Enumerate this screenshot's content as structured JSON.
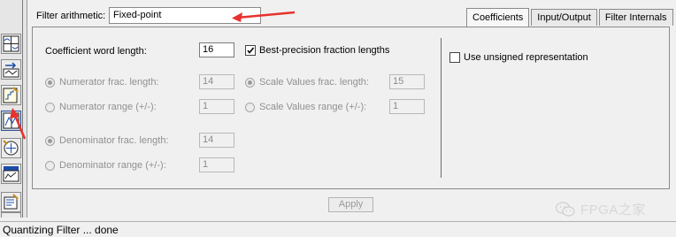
{
  "filter_arithmetic": {
    "label": "Filter arithmetic:",
    "value": "Fixed-point"
  },
  "tabs": [
    {
      "label": "Coefficients",
      "active": true
    },
    {
      "label": "Input/Output",
      "active": false
    },
    {
      "label": "Filter Internals",
      "active": false
    }
  ],
  "coefficients": {
    "word_length_label": "Coefficient word length:",
    "word_length_value": "16",
    "best_precision_label": "Best-precision fraction lengths",
    "best_precision_checked": true,
    "numerator_frac_label": "Numerator frac. length:",
    "numerator_frac_value": "14",
    "numerator_range_label": "Numerator range (+/-):",
    "numerator_range_value": "1",
    "scale_frac_label": "Scale Values frac. length:",
    "scale_frac_value": "15",
    "scale_range_label": "Scale Values range (+/-):",
    "scale_range_value": "1",
    "denominator_frac_label": "Denominator frac. length:",
    "denominator_frac_value": "14",
    "denominator_range_label": "Denominator range (+/-):",
    "denominator_range_value": "1",
    "unsigned_label": "Use unsigned representation",
    "unsigned_checked": false
  },
  "apply_label": "Apply",
  "status": "Quantizing Filter ... done",
  "watermark": "FPGA之家",
  "toolbar_icons": [
    "filter-design-icon",
    "import-filter-icon",
    "quantize-filter-icon",
    "transform-filter-icon",
    "multirate-icon",
    "realize-model-icon",
    "sos-icon",
    "pole-zero-editor-icon"
  ],
  "colors": {
    "annotation_arrow": "#e8312d",
    "selection": "#33518f"
  }
}
